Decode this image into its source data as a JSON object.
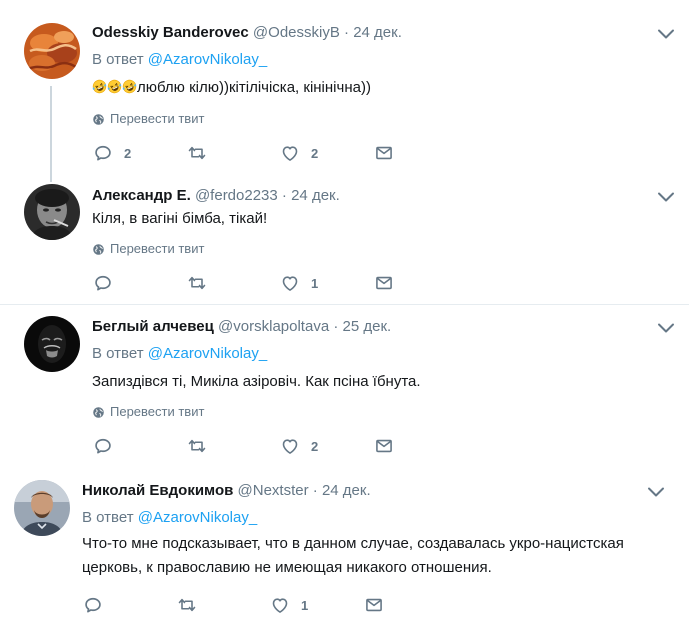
{
  "tweets": [
    {
      "name": "Odesskiy Banderovec",
      "handle": "@OdesskiyB",
      "dot": "·",
      "date": "24 дек.",
      "reply_prefix": "В ответ",
      "reply_mention": "@AzarovNikolay_",
      "emoji": [
        "rolling-on-floor-laughing",
        "rolling-on-floor-laughing",
        "rolling-on-floor-laughing"
      ],
      "text": "люблю кілю))кітілічіска, кінінічна))",
      "translate": "Перевести твит",
      "replies": "2",
      "retweets": "",
      "likes": "2"
    },
    {
      "name": "Александр Е.",
      "handle": "@ferdo2233",
      "dot": "·",
      "date": "24 дек.",
      "text": "Кіля, в вагіні бімба, тікай!",
      "translate": "Перевести твит",
      "replies": "",
      "retweets": "",
      "likes": "1"
    },
    {
      "name": "Беглый алчевец",
      "handle": "@vorsklapoltava",
      "dot": "·",
      "date": "25 дек.",
      "reply_prefix": "В ответ",
      "reply_mention": "@AzarovNikolay_",
      "text": "Запиздівся ті, Микіла азіровіч. Как псіна їбнута.",
      "translate": "Перевести твит",
      "replies": "",
      "retweets": "",
      "likes": "2"
    },
    {
      "name": "Николай Евдокимов",
      "handle": "@Nextster",
      "dot": "·",
      "date": "24 дек.",
      "reply_prefix": "В ответ",
      "reply_mention": "@AzarovNikolay_",
      "text": "Что-то мне подсказывает, что в данном случае, создавалась укро-нацистская церковь, к православию не имеющая никакого отношения.",
      "replies": "",
      "retweets": "",
      "likes": "1"
    }
  ],
  "icons": {
    "reply": "reply-icon",
    "retweet": "retweet-icon",
    "like": "heart-icon",
    "dm": "envelope-icon",
    "globe": "globe-icon",
    "caret": "chevron-down-icon"
  },
  "colors": {
    "text": "#14171a",
    "muted": "#657786",
    "link": "#1da1f2",
    "divider": "#e6ecf0",
    "thread_line": "#ccd6dd"
  }
}
